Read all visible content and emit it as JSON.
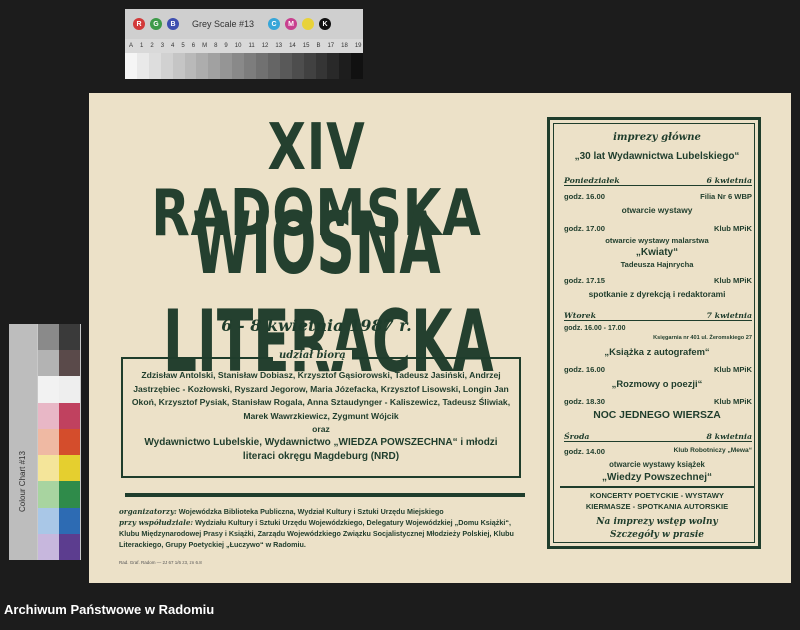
{
  "greyscale": {
    "title": "Grey Scale #13",
    "rgb": [
      "R",
      "G",
      "B"
    ],
    "cmyk": [
      "C",
      "M",
      "Y",
      "K"
    ],
    "scale": [
      "A",
      "1",
      "2",
      "3",
      "4",
      "5",
      "6",
      "M",
      "8",
      "9",
      "10",
      "11",
      "12",
      "13",
      "14",
      "15",
      "B",
      "17",
      "18",
      "19"
    ]
  },
  "colorchart": {
    "label": "Colour Chart #13"
  },
  "poster": {
    "title_line1": "XIV RADOMSKA",
    "title_line2": "WIOSNA LITERACKA",
    "dates": "6 - 8 kwietnia 1987 r.",
    "participants_heading": "udział biorą",
    "participants_names": "Zdzisław Antolski, Stanisław Dobiasz, Krzysztof Gąsiorowski, Tadeusz Jasiński, Andrzej Jastrzębiec - Kozłowski, Ryszard Jegorow, Maria Józefacka, Krzysztof Lisowski, Longin Jan Okoń, Krzysztof Pysiak, Stanisław Rogala, Anna Sztaudynger - Kaliszewicz, Tadeusz Śliwiak, Marek Wawrzkiewicz, Zygmunt Wójcik",
    "participants_oraz": "oraz",
    "participants_publishers": "Wydawnictwo Lubelskie, Wydawnictwo „WIEDZA POWSZECHNA“ i młodzi literaci okręgu Magdeburg (NRD)",
    "organizers_lead": "organizatorzy:",
    "organizers_text": "Wojewódzka Biblioteka Publiczna, Wydział Kultury i Sztuki Urzędu Miejskiego",
    "cooperation_lead": "przy współudziale:",
    "cooperation_text": "Wydziału Kultury i Sztuki Urzędu Wojewódzkiego, Delegatury Wojewódzkiej „Domu Książki“, Klubu Międzynarodowej Prasy i Książki, Zarządu Wojewódzkiego Związku Socjalistycznej Młodzieży Polskiej, Klubu Literackiego, Grupy Poetyckiej „Łuczywo“ w Radomiu.",
    "print_note": "Rad. Graf. Radom — 2J 67 1/6 z3, zn 6.8"
  },
  "program": {
    "heading": "imprezy główne",
    "subheading": "„30 lat Wydawnictwa Lubelskiego“",
    "days": [
      {
        "day": "Poniedziałek",
        "date": "6 kwietnia",
        "events": [
          {
            "time": "godz. 16.00",
            "place": "Filia Nr 6 WBP",
            "lines": [
              "otwarcie wystawy"
            ]
          },
          {
            "time": "godz. 17.00",
            "place": "Klub MPiK",
            "lines": [
              "otwarcie wystawy malarstwa",
              "„Kwiaty“",
              "Tadeusza Hajnrycha"
            ]
          },
          {
            "time": "godz. 17.15",
            "place": "Klub MPiK",
            "lines": [
              "spotkanie z dyrekcją i redaktorami"
            ]
          }
        ]
      },
      {
        "day": "Wtorek",
        "date": "7 kwietnia",
        "events": [
          {
            "time": "godz. 16.00 - 17.00",
            "place": "Księgarnia nr 401 ul. Żeromskiego 27",
            "lines": [
              "„Książka z autografem“"
            ]
          },
          {
            "time": "godz. 16.00",
            "place": "Klub MPiK",
            "lines": [
              "„Rozmowy o poezji“"
            ]
          },
          {
            "time": "godz. 18.30",
            "place": "Klub MPiK",
            "lines": [
              "NOC JEDNEGO WIERSZA"
            ]
          }
        ]
      },
      {
        "day": "Środa",
        "date": "8 kwietnia",
        "events": [
          {
            "time": "godz. 14.00",
            "place": "Klub Robotniczy „Mewa“",
            "lines": [
              "otwarcie wystawy książek",
              "„Wiedzy Powszechnej“"
            ]
          }
        ]
      }
    ],
    "concerts_line1": "KONCERTY POETYCKIE - WYSTAWY",
    "concerts_line2": "KIERMASZE - SPOTKANIA AUTORSKIE",
    "closing_line1": "Na imprezy wstęp wolny",
    "closing_line2": "Szczegóły w prasie"
  },
  "footer": {
    "credit": "Archiwum Państwowe w Radomiu"
  },
  "colors": {
    "ink": "#1f3d2c",
    "paper": "#ece1c8",
    "background": "#1c1c1c"
  }
}
